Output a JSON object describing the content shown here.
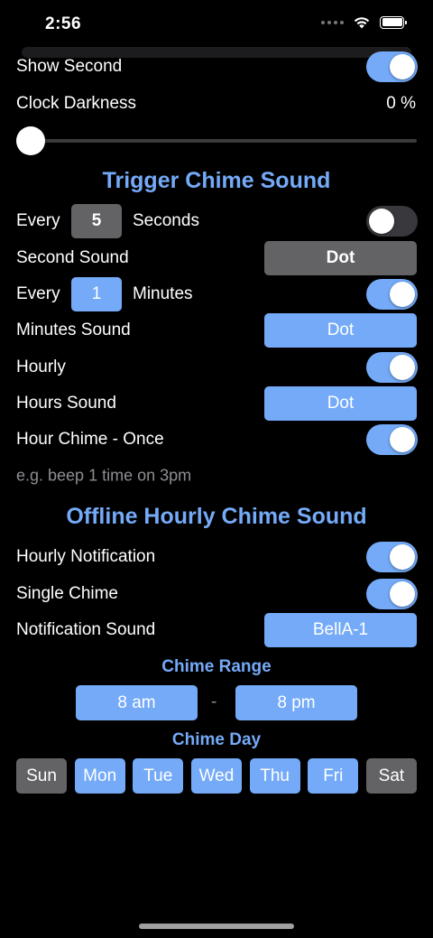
{
  "status_bar": {
    "time": "2:56",
    "icons": [
      "signal-dots-icon",
      "wifi-icon",
      "battery-icon"
    ]
  },
  "display": {
    "show_second": {
      "label": "Show Second",
      "on": true
    },
    "clock_darkness": {
      "label": "Clock Darkness",
      "value": "0 %",
      "level": 0
    }
  },
  "trigger": {
    "title": "Trigger Chime Sound",
    "every_seconds": {
      "prefix": "Every",
      "value": "5",
      "unit": "Seconds",
      "on": false
    },
    "second_sound": {
      "label": "Second Sound",
      "value": "Dot"
    },
    "every_minutes": {
      "prefix": "Every",
      "value": "1",
      "unit": "Minutes",
      "on": true
    },
    "minutes_sound": {
      "label": "Minutes Sound",
      "value": "Dot"
    },
    "hourly": {
      "label": "Hourly",
      "on": true
    },
    "hours_sound": {
      "label": "Hours Sound",
      "value": "Dot"
    },
    "hour_chime_once": {
      "label": "Hour Chime - Once",
      "on": true
    },
    "hint": "e.g. beep 1 time on 3pm"
  },
  "offline": {
    "title": "Offline Hourly Chime Sound",
    "hourly_notification": {
      "label": "Hourly Notification",
      "on": true
    },
    "single_chime": {
      "label": "Single Chime",
      "on": true
    },
    "notification_sound": {
      "label": "Notification Sound",
      "value": "BellA-1"
    },
    "chime_range": {
      "title": "Chime Range",
      "start": "8 am",
      "separator": "-",
      "end": "8 pm"
    },
    "chime_day": {
      "title": "Chime Day",
      "days": [
        {
          "label": "Sun",
          "selected": false
        },
        {
          "label": "Mon",
          "selected": true
        },
        {
          "label": "Tue",
          "selected": true
        },
        {
          "label": "Wed",
          "selected": true
        },
        {
          "label": "Thu",
          "selected": true
        },
        {
          "label": "Fri",
          "selected": true
        },
        {
          "label": "Sat",
          "selected": false
        }
      ]
    }
  },
  "colors": {
    "accent": "#74aaf7",
    "inactive": "#636366",
    "background": "#000000"
  }
}
